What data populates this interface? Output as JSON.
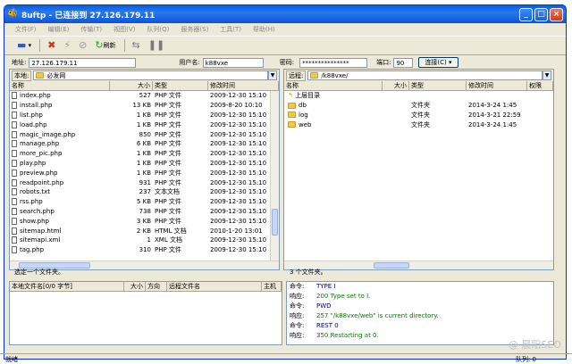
{
  "window": {
    "title": "8uftp - 已连接到 27.126.179.11"
  },
  "menu": [
    "文件(F)",
    "编辑(E)",
    "传输(T)",
    "视图(V)",
    "队列(Q)",
    "服务器(S)",
    "工具(T)",
    "帮助(H)"
  ],
  "toolbar": {
    "refresh_label": "刷新"
  },
  "connection": {
    "address_label": "地址:",
    "address_value": "27.126.179.11",
    "user_label": "用户名:",
    "user_value": "k88vxe",
    "password_label": "密码:",
    "password_value": "***************",
    "port_label": "端口:",
    "port_value": "90",
    "connect_label": "连接(C)"
  },
  "local": {
    "path_label": "本地:",
    "path_value": "必发网",
    "columns": [
      "名称",
      "大小",
      "类型",
      "修改时间"
    ],
    "files": [
      {
        "name": "index.php",
        "size": "527",
        "type": "PHP 文件",
        "mtime": "2009-12-30 15:10"
      },
      {
        "name": "install.php",
        "size": "13 KB",
        "type": "PHP 文件",
        "mtime": "2009-8-20 10:10"
      },
      {
        "name": "list.php",
        "size": "1 KB",
        "type": "PHP 文件",
        "mtime": "2009-12-30 15:10"
      },
      {
        "name": "load.php",
        "size": "1 KB",
        "type": "PHP 文件",
        "mtime": "2009-12-30 15:10"
      },
      {
        "name": "magic_image.php",
        "size": "850",
        "type": "PHP 文件",
        "mtime": "2009-12-30 15:10"
      },
      {
        "name": "manage.php",
        "size": "6 KB",
        "type": "PHP 文件",
        "mtime": "2009-12-30 15:10"
      },
      {
        "name": "more_pic.php",
        "size": "1 KB",
        "type": "PHP 文件",
        "mtime": "2009-12-30 15:10"
      },
      {
        "name": "play.php",
        "size": "1 KB",
        "type": "PHP 文件",
        "mtime": "2009-12-30 15:10"
      },
      {
        "name": "preview.php",
        "size": "1 KB",
        "type": "PHP 文件",
        "mtime": "2009-12-30 15:10"
      },
      {
        "name": "readpoint.php",
        "size": "931",
        "type": "PHP 文件",
        "mtime": "2009-12-30 15:10"
      },
      {
        "name": "robots.txt",
        "size": "237",
        "type": "文本文档",
        "mtime": "2009-12-30 15:10"
      },
      {
        "name": "rss.php",
        "size": "5 KB",
        "type": "PHP 文件",
        "mtime": "2009-12-30 15:10"
      },
      {
        "name": "search.php",
        "size": "738",
        "type": "PHP 文件",
        "mtime": "2009-12-30 15:10"
      },
      {
        "name": "show.php",
        "size": "3 KB",
        "type": "PHP 文件",
        "mtime": "2009-12-30 15:10"
      },
      {
        "name": "sitemap.html",
        "size": "2 KB",
        "type": "HTML 文档",
        "mtime": "2010-1-20 13:01"
      },
      {
        "name": "sitemapi.xml",
        "size": "1",
        "type": "XML 文档",
        "mtime": "2009-12-30 15:10"
      },
      {
        "name": "tag.php",
        "size": "310",
        "type": "PHP 文件",
        "mtime": "2009-12-30 15:10"
      }
    ],
    "status": "选定一个文件夹。"
  },
  "remote": {
    "path_label": "远程:",
    "path_value": "/k88vxe/",
    "columns": [
      "名称",
      "大小",
      "类型",
      "修改时间",
      "权限"
    ],
    "parent_label": "上层目录",
    "files": [
      {
        "name": "db",
        "size": "",
        "type": "文件夹",
        "mtime": "2014-3-24 1:45"
      },
      {
        "name": "log",
        "size": "",
        "type": "文件夹",
        "mtime": "2014-3-21 22:59"
      },
      {
        "name": "web",
        "size": "",
        "type": "文件夹",
        "mtime": "2014-3-24 1:45"
      }
    ],
    "status": "3 个文件夹。"
  },
  "queue": {
    "columns": [
      "本地文件名[0/0 字节]",
      "大小",
      "方向",
      "远程文件名",
      "主机"
    ]
  },
  "log": [
    {
      "k": "命令:",
      "v": "TYPE I"
    },
    {
      "k": "响应:",
      "v": "200 Type set to I."
    },
    {
      "k": "命令:",
      "v": "PWD"
    },
    {
      "k": "响应:",
      "v": "257 \"/k88vxe/web\" is current directory."
    },
    {
      "k": "命令:",
      "v": "REST 0"
    },
    {
      "k": "响应:",
      "v": "350 Restarting at 0."
    }
  ],
  "statusbar": {
    "left": "就绪",
    "right": "队列: 0"
  },
  "watermark": "@ 晨阳SEO"
}
